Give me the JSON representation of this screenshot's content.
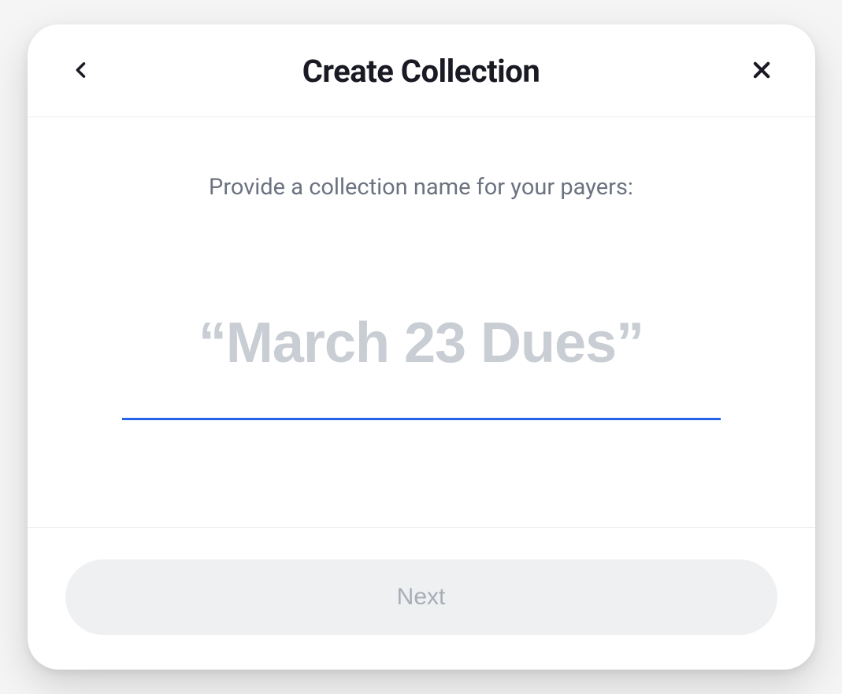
{
  "header": {
    "title": "Create Collection"
  },
  "content": {
    "prompt": "Provide a collection name for your payers:",
    "input_value": "",
    "input_placeholder": "“March 23 Dues”"
  },
  "footer": {
    "next_label": "Next"
  },
  "colors": {
    "accent": "#2364e8",
    "text_primary": "#1a1a24",
    "text_muted": "#6b7280",
    "placeholder": "#c9cdd4",
    "button_disabled_bg": "#eef0f2",
    "button_disabled_fg": "#a8adb7"
  }
}
